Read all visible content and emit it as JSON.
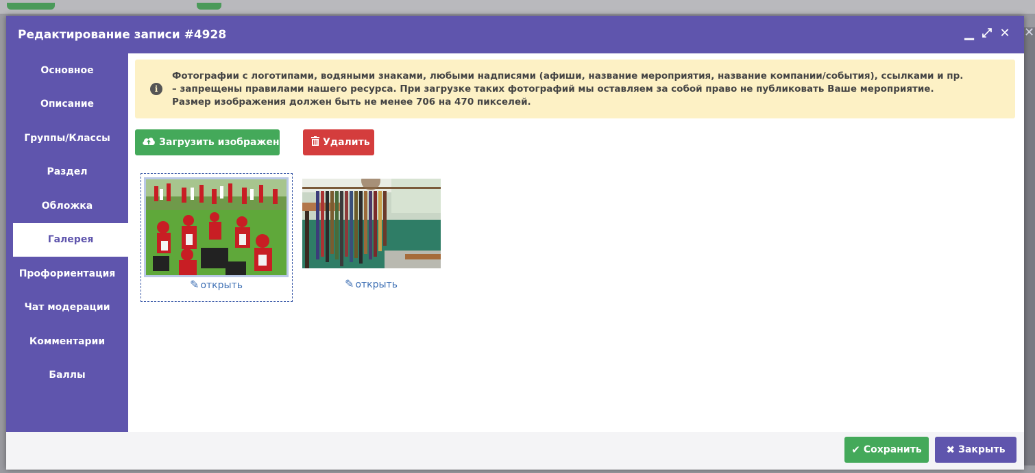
{
  "header": {
    "title": "Редактирование записи #4928",
    "controls": [
      "minimize-icon",
      "expand-icon",
      "close-icon"
    ]
  },
  "sidebar": {
    "items": [
      {
        "label": "Основное"
      },
      {
        "label": "Описание"
      },
      {
        "label": "Группы/Классы"
      },
      {
        "label": "Раздел"
      },
      {
        "label": "Обложка"
      },
      {
        "label": "Галерея",
        "active": true
      },
      {
        "label": "Профориентация"
      },
      {
        "label": "Чат модерации"
      },
      {
        "label": "Комментарии"
      },
      {
        "label": "Баллы"
      }
    ]
  },
  "alert": {
    "icon": "info-icon",
    "line1": "Фотографии с логотипами, водяными знаками, любыми надписями (афиши, название мероприятия, название компании/события), ссылками и пр.",
    "line2": "– запрещены правилами нашего ресурса. При загрузке таких фотографий мы оставляем за собой право не публиковать Ваше мероприятие.",
    "line3": "Размер изображения должен быть не менее 706 на 470 пикселей."
  },
  "actions": {
    "upload_label": "Загрузить изображени",
    "upload_icon": "cloud-upload-icon",
    "delete_label": "Удалить",
    "delete_icon": "trash-icon"
  },
  "gallery": {
    "items": [
      {
        "open_label": "открыть",
        "selected": true,
        "image": "folk-festival-photo"
      },
      {
        "open_label": "открыть",
        "selected": false,
        "image": "woven-belts-photo"
      }
    ]
  },
  "footer": {
    "save_label": "Сохранить",
    "close_label": "Закрыть"
  },
  "colors": {
    "accent": "#5f55ad",
    "success": "#44a95a",
    "danger": "#d43d3d",
    "warning_bg": "#fdf1c5",
    "link": "#3d6fb4"
  }
}
